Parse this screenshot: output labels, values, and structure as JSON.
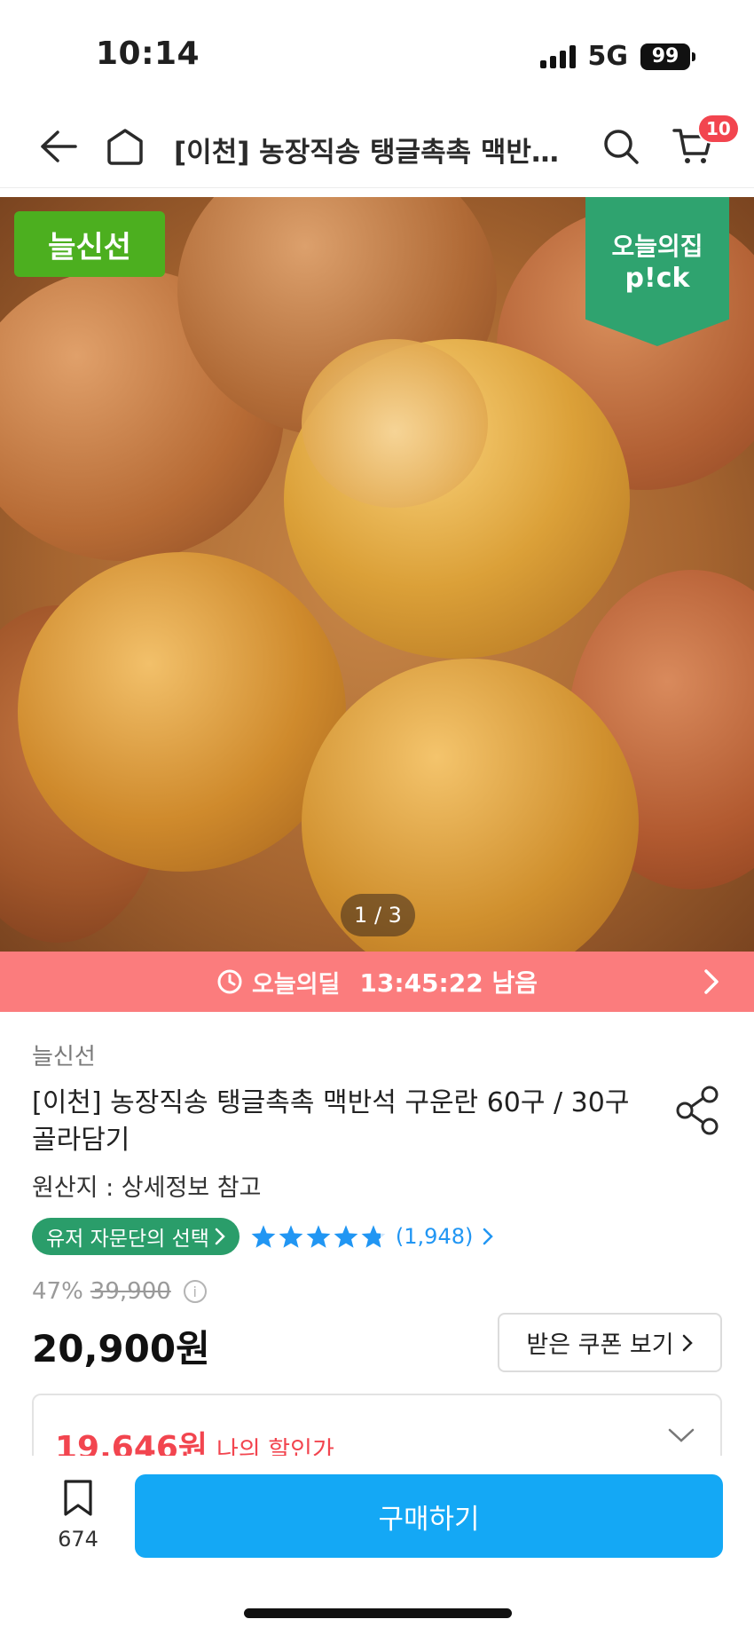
{
  "status_bar": {
    "time": "10:14",
    "network": "5G",
    "battery": "99"
  },
  "nav": {
    "title": "[이천] 농장직송 탱글촉촉 맥반석 구운란 60구 / 30구 골라담기",
    "cart_count": "10"
  },
  "hero": {
    "label": "늘신선",
    "pick_line1": "오늘의집",
    "pick_line2": "p!ck",
    "counter": "1 / 3"
  },
  "deal": {
    "label": "오늘의딜",
    "timer": "13:45:22 남음"
  },
  "product": {
    "brand": "늘신선",
    "title": "[이천] 농장직송 탱글촉촉 맥반석 구운란 60구 / 30구 골라담기",
    "origin": "원산지 : 상세정보 참고",
    "advisor_badge": "유저 자문단의 선택",
    "rating": 4.8,
    "review_count": "(1,948)",
    "discount_rate": "47%",
    "original_price": "39,900",
    "price": "20,900원",
    "coupon_button": "받은 쿠폰 보기",
    "my_price": "19,646원",
    "my_price_label": "나의 할인가"
  },
  "bottom": {
    "bookmark_count": "674",
    "buy_button": "구매하기"
  },
  "colors": {
    "accent": "#14a8f5",
    "sale": "#f2454f",
    "deal_banner": "#fb7c7d",
    "advisor": "#2a9d6a",
    "brand_label": "#4caf1f"
  },
  "icons": {
    "back": "back-arrow-icon",
    "home": "home-icon",
    "search": "search-icon",
    "cart": "cart-icon",
    "share": "share-icon",
    "clock": "clock-icon",
    "bookmark": "bookmark-icon"
  }
}
